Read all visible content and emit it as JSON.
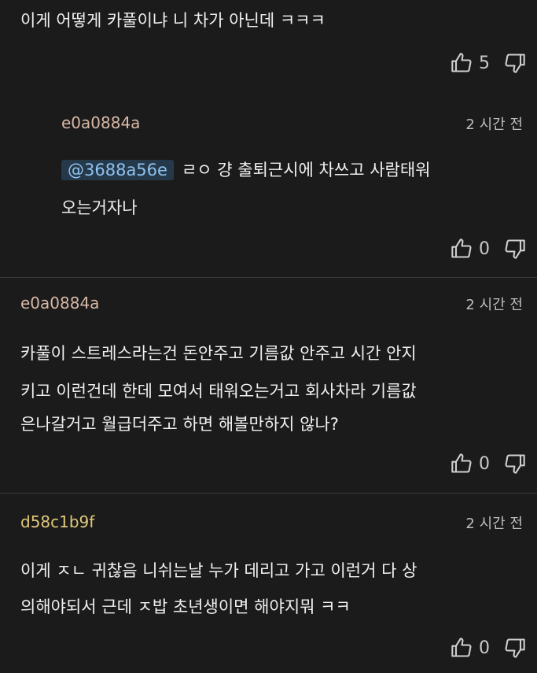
{
  "top_comment": {
    "text": "이게 어떻게 카풀이냐 니 차가 아닌데 ㅋㅋㅋ",
    "likes": "5"
  },
  "comments": [
    {
      "author": "e0a0884a",
      "author_color": "#d8b8a6",
      "time": "2 시간 전",
      "mention": "@3688a56e",
      "lines": [
        "ㄹㅇ 걍 출퇴근시에 차쓰고 사람태워",
        "오는거자나"
      ],
      "likes": "0"
    },
    {
      "author": "e0a0884a",
      "author_color": "#d8b8a6",
      "time": "2 시간 전",
      "lines": [
        "카풀이 스트레스라는건 돈안주고 기름값 안주고 시간 안지",
        "키고 이런건데 한데 모여서 태워오는거고 회사차라 기름값",
        "은나갈거고 월급더주고 하면 해볼만하지 않나?"
      ],
      "likes": "0"
    },
    {
      "author": "d58c1b9f",
      "author_color": "#e2c87a",
      "time": "2 시간 전",
      "lines": [
        "이게 ㅈㄴ 귀찮음 니쉬는날 누가 데리고 가고 이런거 다 상",
        "의해야되서 근데 ㅈ밥 초년생이면 해야지뭐 ㅋㅋ"
      ],
      "likes": "0"
    }
  ],
  "icons": [
    "thumb-up-icon",
    "thumb-down-icon"
  ]
}
